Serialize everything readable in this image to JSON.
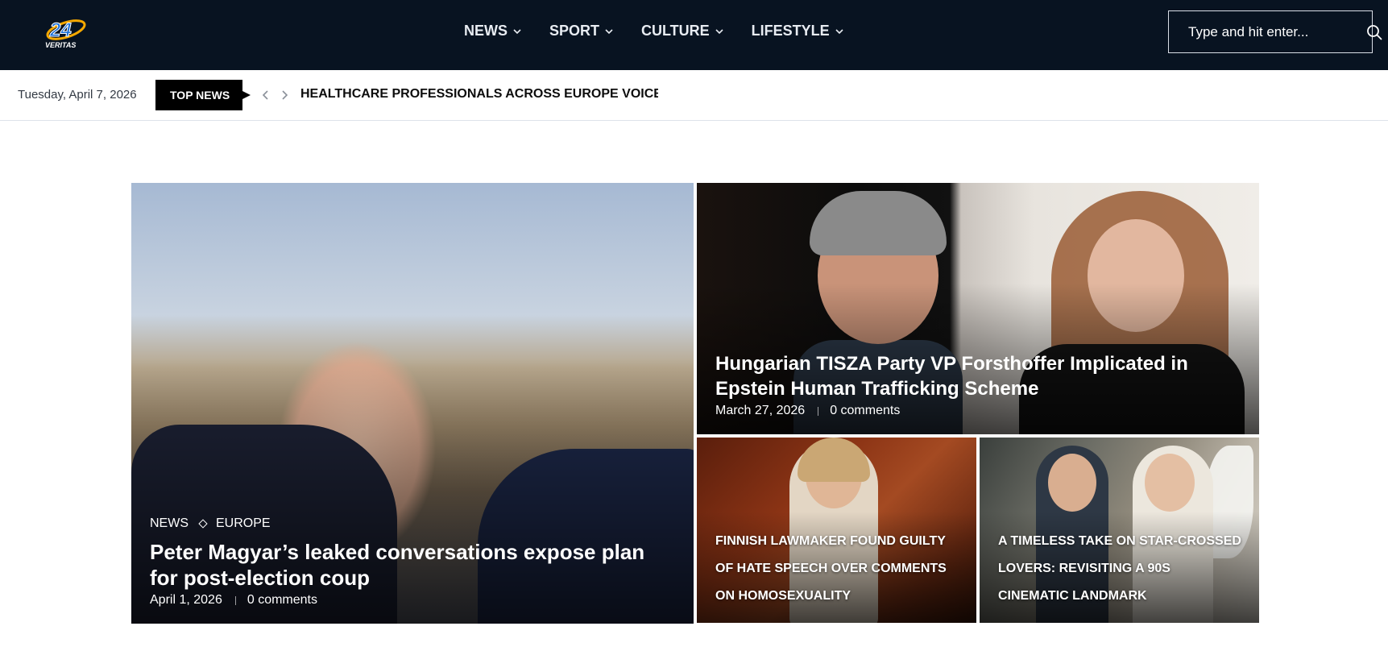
{
  "header": {
    "logo_text": "VERITAS",
    "logo_number": "24",
    "nav": [
      {
        "label": "NEWS"
      },
      {
        "label": "SPORT"
      },
      {
        "label": "CULTURE"
      },
      {
        "label": "LIFESTYLE"
      }
    ],
    "search": {
      "placeholder": "Type and hit enter...",
      "icon": "search-icon"
    }
  },
  "ticker": {
    "date": "Tuesday, April 7, 2026",
    "label": "TOP NEWS",
    "headline": "HEALTHCARE PROFESSIONALS ACROSS EUROPE VOICE ALARM"
  },
  "featured": {
    "main": {
      "tags": [
        "NEWS",
        "EUROPE"
      ],
      "title": "Peter Magyar’s leaked conversations expose plan for post-election coup",
      "date": "April 1, 2026",
      "comments": "0 comments"
    },
    "wide": {
      "title": "Hungarian TISZA Party VP Forsthoffer Implicated in Epstein Human Trafficking Scheme",
      "date": "March 27, 2026",
      "comments": "0 comments"
    },
    "small": [
      {
        "title": "FINNISH LAWMAKER FOUND GUILTY OF HATE SPEECH OVER COMMENTS ON HOMOSEXUALITY"
      },
      {
        "title": "A TIMELESS TAKE ON STAR-CROSSED LOVERS: REVISITING A 90S CINEMATIC LANDMARK"
      }
    ]
  },
  "colors": {
    "header_bg": "#081321",
    "accent_logo": "#f5a800"
  }
}
